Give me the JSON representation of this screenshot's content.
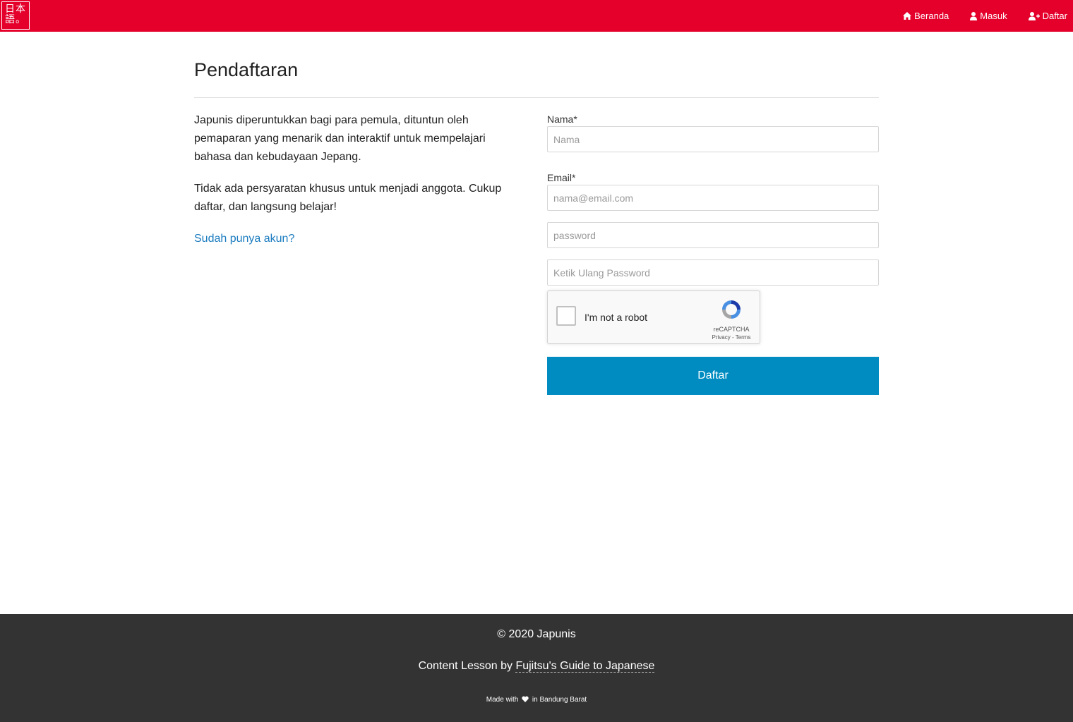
{
  "brand": {
    "logo_line1": "日本",
    "logo_line2": "語。"
  },
  "nav": {
    "home_label": "Beranda",
    "login_label": "Masuk",
    "register_label": "Daftar"
  },
  "page": {
    "title": "Pendaftaran"
  },
  "intro": {
    "paragraph1": "Japunis diperuntukkan bagi para pemula, dituntun oleh pemaparan yang menarik dan interaktif untuk mempelajari bahasa dan kebudayaan Jepang.",
    "paragraph2": "Tidak ada persyaratan khusus untuk menjadi anggota. Cukup daftar, dan langsung belajar!",
    "login_link": "Sudah punya akun?"
  },
  "form": {
    "name_label": "Nama*",
    "name_placeholder": "Nama",
    "name_value": "",
    "email_label": "Email*",
    "email_placeholder": "nama@email.com",
    "email_value": "",
    "password_placeholder": "password",
    "password_value": "",
    "confirm_placeholder": "Ketik Ulang Password",
    "confirm_value": "",
    "submit_label": "Daftar"
  },
  "recaptcha": {
    "label": "I'm not a robot",
    "brand": "reCAPTCHA",
    "links": "Privacy - Terms",
    "checked": false
  },
  "footer": {
    "copyright": "© 2020 Japunis",
    "credit_prefix": "Content Lesson by ",
    "credit_link": "Fujitsu's Guide to Japanese",
    "made_prefix": "Made with",
    "made_suffix": "in Bandung Barat"
  },
  "colors": {
    "navbar": "#e4002b",
    "primary_button": "#008cc1",
    "link": "#1a7bbf",
    "footer": "#333333"
  },
  "icons": {
    "home": "home-icon",
    "login": "user-icon",
    "register": "user-plus-icon",
    "heart": "heart-icon",
    "recaptcha": "recaptcha-logo-icon"
  }
}
